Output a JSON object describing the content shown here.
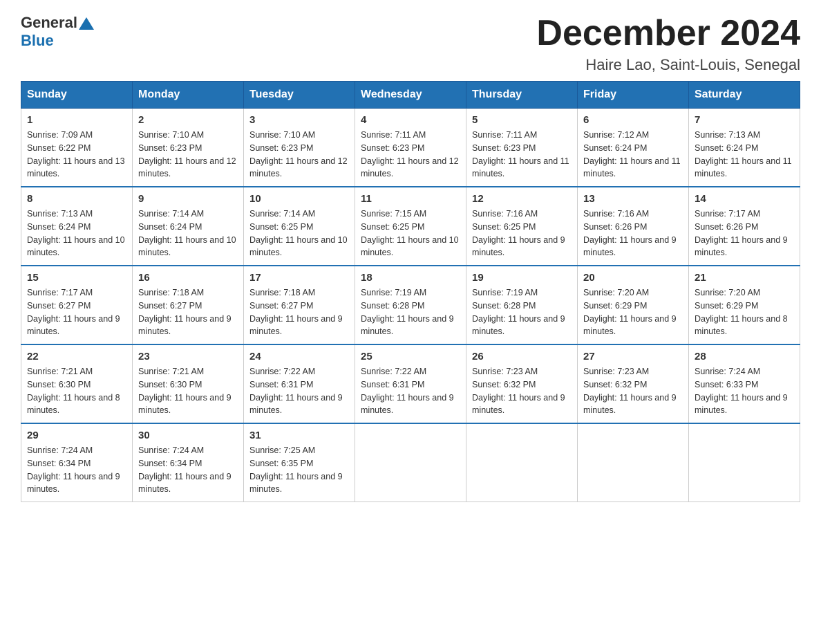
{
  "header": {
    "logo_general": "General",
    "logo_blue": "Blue",
    "month_title": "December 2024",
    "location": "Haire Lao, Saint-Louis, Senegal"
  },
  "days_of_week": [
    "Sunday",
    "Monday",
    "Tuesday",
    "Wednesday",
    "Thursday",
    "Friday",
    "Saturday"
  ],
  "weeks": [
    [
      {
        "day": "1",
        "sunrise": "7:09 AM",
        "sunset": "6:22 PM",
        "daylight": "11 hours and 13 minutes."
      },
      {
        "day": "2",
        "sunrise": "7:10 AM",
        "sunset": "6:23 PM",
        "daylight": "11 hours and 12 minutes."
      },
      {
        "day": "3",
        "sunrise": "7:10 AM",
        "sunset": "6:23 PM",
        "daylight": "11 hours and 12 minutes."
      },
      {
        "day": "4",
        "sunrise": "7:11 AM",
        "sunset": "6:23 PM",
        "daylight": "11 hours and 12 minutes."
      },
      {
        "day": "5",
        "sunrise": "7:11 AM",
        "sunset": "6:23 PM",
        "daylight": "11 hours and 11 minutes."
      },
      {
        "day": "6",
        "sunrise": "7:12 AM",
        "sunset": "6:24 PM",
        "daylight": "11 hours and 11 minutes."
      },
      {
        "day": "7",
        "sunrise": "7:13 AM",
        "sunset": "6:24 PM",
        "daylight": "11 hours and 11 minutes."
      }
    ],
    [
      {
        "day": "8",
        "sunrise": "7:13 AM",
        "sunset": "6:24 PM",
        "daylight": "11 hours and 10 minutes."
      },
      {
        "day": "9",
        "sunrise": "7:14 AM",
        "sunset": "6:24 PM",
        "daylight": "11 hours and 10 minutes."
      },
      {
        "day": "10",
        "sunrise": "7:14 AM",
        "sunset": "6:25 PM",
        "daylight": "11 hours and 10 minutes."
      },
      {
        "day": "11",
        "sunrise": "7:15 AM",
        "sunset": "6:25 PM",
        "daylight": "11 hours and 10 minutes."
      },
      {
        "day": "12",
        "sunrise": "7:16 AM",
        "sunset": "6:25 PM",
        "daylight": "11 hours and 9 minutes."
      },
      {
        "day": "13",
        "sunrise": "7:16 AM",
        "sunset": "6:26 PM",
        "daylight": "11 hours and 9 minutes."
      },
      {
        "day": "14",
        "sunrise": "7:17 AM",
        "sunset": "6:26 PM",
        "daylight": "11 hours and 9 minutes."
      }
    ],
    [
      {
        "day": "15",
        "sunrise": "7:17 AM",
        "sunset": "6:27 PM",
        "daylight": "11 hours and 9 minutes."
      },
      {
        "day": "16",
        "sunrise": "7:18 AM",
        "sunset": "6:27 PM",
        "daylight": "11 hours and 9 minutes."
      },
      {
        "day": "17",
        "sunrise": "7:18 AM",
        "sunset": "6:27 PM",
        "daylight": "11 hours and 9 minutes."
      },
      {
        "day": "18",
        "sunrise": "7:19 AM",
        "sunset": "6:28 PM",
        "daylight": "11 hours and 9 minutes."
      },
      {
        "day": "19",
        "sunrise": "7:19 AM",
        "sunset": "6:28 PM",
        "daylight": "11 hours and 9 minutes."
      },
      {
        "day": "20",
        "sunrise": "7:20 AM",
        "sunset": "6:29 PM",
        "daylight": "11 hours and 9 minutes."
      },
      {
        "day": "21",
        "sunrise": "7:20 AM",
        "sunset": "6:29 PM",
        "daylight": "11 hours and 8 minutes."
      }
    ],
    [
      {
        "day": "22",
        "sunrise": "7:21 AM",
        "sunset": "6:30 PM",
        "daylight": "11 hours and 8 minutes."
      },
      {
        "day": "23",
        "sunrise": "7:21 AM",
        "sunset": "6:30 PM",
        "daylight": "11 hours and 9 minutes."
      },
      {
        "day": "24",
        "sunrise": "7:22 AM",
        "sunset": "6:31 PM",
        "daylight": "11 hours and 9 minutes."
      },
      {
        "day": "25",
        "sunrise": "7:22 AM",
        "sunset": "6:31 PM",
        "daylight": "11 hours and 9 minutes."
      },
      {
        "day": "26",
        "sunrise": "7:23 AM",
        "sunset": "6:32 PM",
        "daylight": "11 hours and 9 minutes."
      },
      {
        "day": "27",
        "sunrise": "7:23 AM",
        "sunset": "6:32 PM",
        "daylight": "11 hours and 9 minutes."
      },
      {
        "day": "28",
        "sunrise": "7:24 AM",
        "sunset": "6:33 PM",
        "daylight": "11 hours and 9 minutes."
      }
    ],
    [
      {
        "day": "29",
        "sunrise": "7:24 AM",
        "sunset": "6:34 PM",
        "daylight": "11 hours and 9 minutes."
      },
      {
        "day": "30",
        "sunrise": "7:24 AM",
        "sunset": "6:34 PM",
        "daylight": "11 hours and 9 minutes."
      },
      {
        "day": "31",
        "sunrise": "7:25 AM",
        "sunset": "6:35 PM",
        "daylight": "11 hours and 9 minutes."
      },
      null,
      null,
      null,
      null
    ]
  ]
}
